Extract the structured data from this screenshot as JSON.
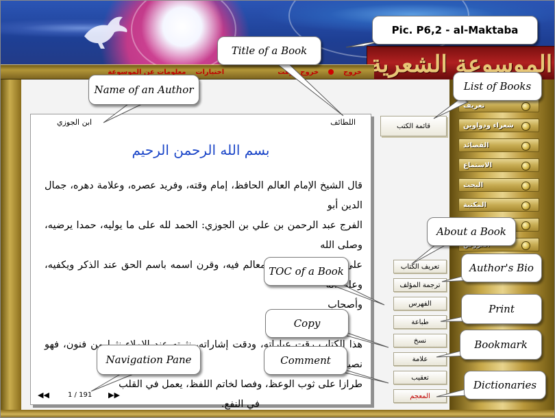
{
  "menu": {
    "items": [
      "خروج",
      "خروج مؤقت",
      "",
      "اختيارات",
      "معلومات عن الموسوعة"
    ]
  },
  "logo": {
    "text": "الموسوعة الشعرية"
  },
  "book": {
    "title": "اللطائف",
    "author": "ابن الجوزي",
    "basmala": "بسم الله الرحمن الرحيم",
    "lines": [
      "قال الشيخ الإمام العالم الحافظ، إمام وقته، وفريد عصره، وعلامة دهره، جمال الدين أبو",
      "الفرج عبد الرحمن بن علي بن الجوزي: الحمد لله على ما يوليه، حمدا يرضيه، وصلى الله",
      "على من اجتمعت كل المعالم فيه، وقرن اسمه باسم الحق عند الذكر ويكفيه، وعلى آله",
      "وأصحاب",
      "",
      "هذا الكتاب رقت عباراته، ودقت إشاراته، نثرته عند الإملاء نثرا من فنون، فهو نصيب",
      "طرازا على ثوب الوعظ، وفصا لخاتم اللفظ، يعمل في القلب",
      "في النفع."
    ]
  },
  "navigation": {
    "first": "◀◀",
    "prev": "",
    "page_count": "1 / 191",
    "next": "",
    "last": "▶▶"
  },
  "buttons": {
    "list_of_books": "قائمة الكتب",
    "about_book": "تعريف الكتاب",
    "author_bio": "ترجمة المؤلف",
    "toc": "الفهرس",
    "print": "طباعة",
    "copy": "نسخ",
    "bookmark": "علامة",
    "comment": "تعقيب",
    "dictionaries": "المعجم"
  },
  "side_menu": [
    "تعريف",
    "شعراء ودواوين",
    "القصائد",
    "الاستماع",
    "البحث",
    "المكتبة",
    "",
    "العروض"
  ],
  "callouts": {
    "pic": "Pic. P6,2 - al-Maktaba",
    "title_of_book": "Title of a Book",
    "name_of_author": "Name of an Author",
    "list_of_books": "List of Books",
    "about_book": "About a Book",
    "author_bio": "Author's Bio",
    "toc": "TOC of a Book",
    "print": "Print",
    "copy": "Copy",
    "bookmark": "Bookmark",
    "comment": "Comment",
    "navigation_pane": "Navigation Pane",
    "dictionaries": "Dictionaries"
  },
  "colors": {
    "menu_text": "#c00000",
    "basmala": "#1a45c8",
    "logo_bg": "#b02020",
    "logo_text": "#e8c777",
    "gold": "#c8a94a"
  }
}
